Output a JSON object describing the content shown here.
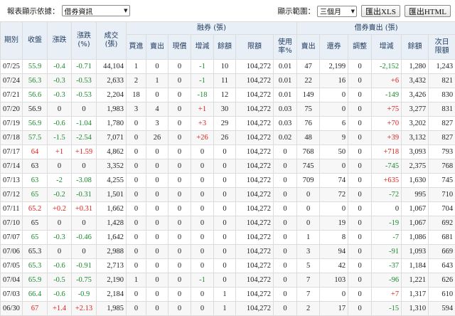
{
  "toolbar": {
    "report_label": "報表顯示依據：",
    "report_value": "借券資訊",
    "range_label": "顯示範圍：",
    "range_value": "三個月",
    "xls_button": "匯出XLS",
    "html_button": "匯出HTML"
  },
  "headers": {
    "date": "期別",
    "close": "收盤",
    "change": "漲跌",
    "change_pct": "漲跌\n(%)",
    "volume": "成交\n(張)",
    "margin_group": "融券 (張)",
    "sbl_group": "借券賣出 (張)",
    "margin_cols": [
      "買進",
      "賣出",
      "現償",
      "增減",
      "餘額",
      "限額",
      "使用\n率%"
    ],
    "sbl_cols": [
      "賣出",
      "還券",
      "調整",
      "增減",
      "餘額",
      "次日\n限額"
    ]
  },
  "colors": {
    "up": "#e0201b",
    "down": "#1b8a2e",
    "header_bg": "#e9eff6"
  },
  "rows": [
    [
      "07/25",
      "55.9",
      "-0.4",
      "-0.71",
      "44,104",
      "1",
      "0",
      "0",
      "-1",
      "10",
      "104,272",
      "0.01",
      "47",
      "2,199",
      "0",
      "-2,152",
      "1,280",
      "1,243"
    ],
    [
      "07/24",
      "56.3",
      "-0.3",
      "-0.53",
      "2,633",
      "2",
      "1",
      "0",
      "-1",
      "11",
      "104,272",
      "0.01",
      "22",
      "16",
      "0",
      "+6",
      "3,432",
      "821"
    ],
    [
      "07/21",
      "56.6",
      "-0.3",
      "-0.53",
      "2,204",
      "18",
      "0",
      "0",
      "-18",
      "12",
      "104,272",
      "0.01",
      "149",
      "0",
      "0",
      "-149",
      "3,426",
      "830"
    ],
    [
      "07/20",
      "56.9",
      "0",
      "0",
      "1,983",
      "3",
      "4",
      "0",
      "+1",
      "30",
      "104,272",
      "0.03",
      "75",
      "0",
      "0",
      "+75",
      "3,277",
      "831"
    ],
    [
      "07/19",
      "56.9",
      "-0.6",
      "-1.04",
      "1,780",
      "0",
      "3",
      "0",
      "+3",
      "29",
      "104,272",
      "0.03",
      "76",
      "6",
      "0",
      "+70",
      "3,202",
      "827"
    ],
    [
      "07/18",
      "57.5",
      "-1.5",
      "-2.54",
      "7,071",
      "0",
      "26",
      "0",
      "+26",
      "26",
      "104,272",
      "0.02",
      "48",
      "9",
      "0",
      "+39",
      "3,132",
      "827"
    ],
    [
      "07/17",
      "64",
      "+1",
      "+1.59",
      "4,862",
      "0",
      "0",
      "0",
      "0",
      "0",
      "104,272",
      "0",
      "768",
      "50",
      "0",
      "+718",
      "3,093",
      "793"
    ],
    [
      "07/14",
      "63",
      "0",
      "0",
      "3,352",
      "0",
      "0",
      "0",
      "0",
      "0",
      "104,272",
      "0",
      "745",
      "0",
      "0",
      "-745",
      "2,375",
      "768"
    ],
    [
      "07/13",
      "63",
      "-2",
      "-3.08",
      "4,255",
      "0",
      "0",
      "0",
      "0",
      "0",
      "104,272",
      "0",
      "709",
      "74",
      "0",
      "+635",
      "1,630",
      "745"
    ],
    [
      "07/12",
      "65",
      "-0.2",
      "-0.31",
      "1,501",
      "0",
      "0",
      "0",
      "0",
      "0",
      "104,272",
      "0",
      "0",
      "72",
      "0",
      "-72",
      "995",
      "710"
    ],
    [
      "07/11",
      "65.2",
      "+0.2",
      "+0.31",
      "1,662",
      "0",
      "0",
      "0",
      "0",
      "0",
      "104,272",
      "0",
      "0",
      "0",
      "0",
      "0",
      "1,067",
      "704"
    ],
    [
      "07/10",
      "65",
      "0",
      "0",
      "1,428",
      "0",
      "0",
      "0",
      "0",
      "0",
      "104,272",
      "0",
      "0",
      "19",
      "0",
      "-19",
      "1,067",
      "692"
    ],
    [
      "07/07",
      "65",
      "-0.3",
      "-0.46",
      "1,642",
      "0",
      "0",
      "0",
      "0",
      "0",
      "104,272",
      "0",
      "1",
      "8",
      "0",
      "-7",
      "1,086",
      "681"
    ],
    [
      "07/06",
      "65.3",
      "0",
      "0",
      "2,988",
      "0",
      "0",
      "0",
      "0",
      "0",
      "104,272",
      "0",
      "3",
      "94",
      "0",
      "-91",
      "1,093",
      "669"
    ],
    [
      "07/05",
      "65.3",
      "-0.6",
      "-0.91",
      "2,713",
      "0",
      "0",
      "0",
      "0",
      "0",
      "104,272",
      "0",
      "5",
      "42",
      "0",
      "-37",
      "1,184",
      "643"
    ],
    [
      "07/04",
      "65.9",
      "-0.5",
      "-0.75",
      "2,190",
      "1",
      "0",
      "0",
      "-1",
      "0",
      "104,272",
      "0",
      "7",
      "103",
      "0",
      "-96",
      "1,221",
      "626"
    ],
    [
      "07/03",
      "66.4",
      "-0.6",
      "-0.9",
      "2,184",
      "0",
      "0",
      "0",
      "0",
      "1",
      "104,272",
      "0",
      "7",
      "0",
      "0",
      "+7",
      "1,317",
      "610"
    ],
    [
      "06/30",
      "67",
      "+1.4",
      "+2.13",
      "1,985",
      "0",
      "0",
      "0",
      "0",
      "1",
      "104,272",
      "0",
      "2",
      "17",
      "0",
      "-15",
      "1,310",
      "594"
    ]
  ]
}
